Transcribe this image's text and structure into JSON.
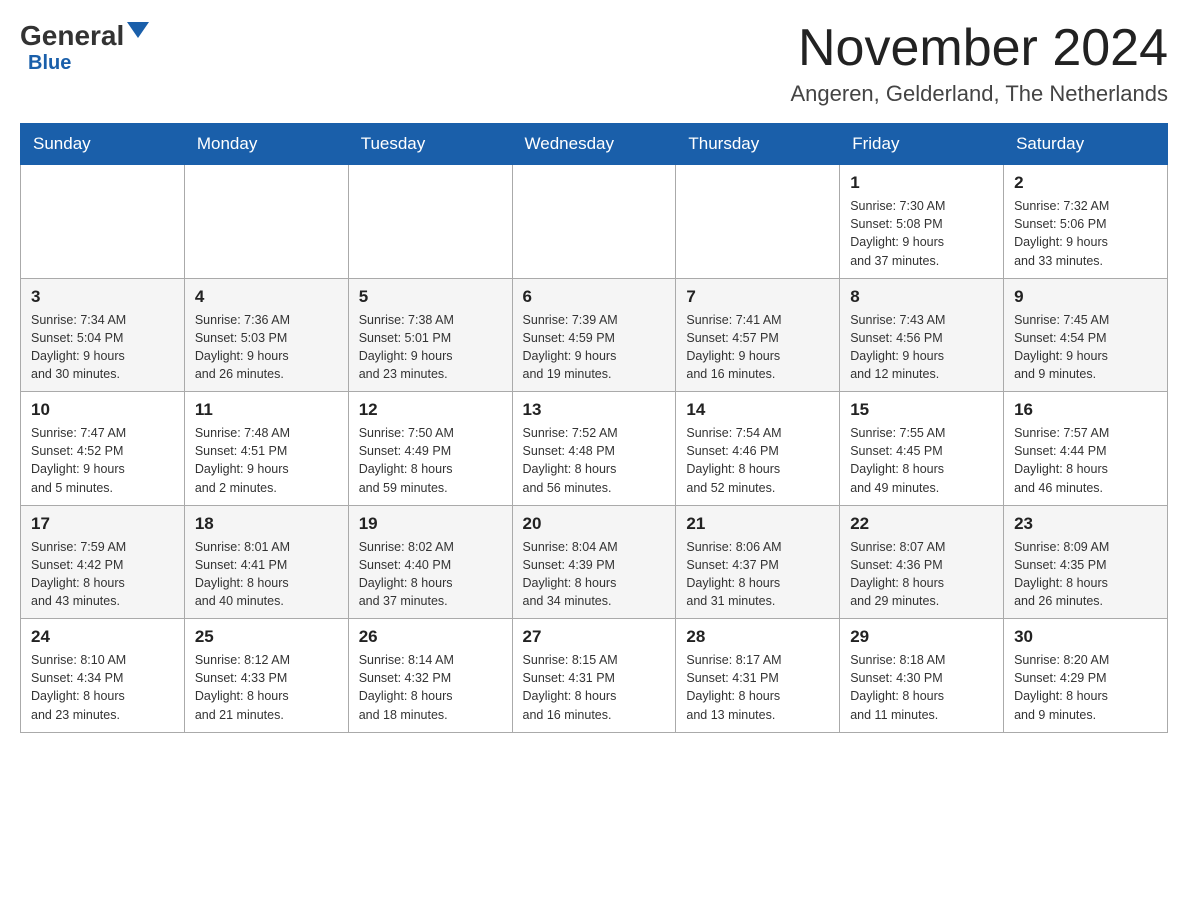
{
  "header": {
    "logo": {
      "general": "General",
      "blue": "Blue"
    },
    "title": "November 2024",
    "location": "Angeren, Gelderland, The Netherlands"
  },
  "calendar": {
    "days": [
      "Sunday",
      "Monday",
      "Tuesday",
      "Wednesday",
      "Thursday",
      "Friday",
      "Saturday"
    ],
    "weeks": [
      [
        {
          "day": "",
          "info": ""
        },
        {
          "day": "",
          "info": ""
        },
        {
          "day": "",
          "info": ""
        },
        {
          "day": "",
          "info": ""
        },
        {
          "day": "",
          "info": ""
        },
        {
          "day": "1",
          "info": "Sunrise: 7:30 AM\nSunset: 5:08 PM\nDaylight: 9 hours\nand 37 minutes."
        },
        {
          "day": "2",
          "info": "Sunrise: 7:32 AM\nSunset: 5:06 PM\nDaylight: 9 hours\nand 33 minutes."
        }
      ],
      [
        {
          "day": "3",
          "info": "Sunrise: 7:34 AM\nSunset: 5:04 PM\nDaylight: 9 hours\nand 30 minutes."
        },
        {
          "day": "4",
          "info": "Sunrise: 7:36 AM\nSunset: 5:03 PM\nDaylight: 9 hours\nand 26 minutes."
        },
        {
          "day": "5",
          "info": "Sunrise: 7:38 AM\nSunset: 5:01 PM\nDaylight: 9 hours\nand 23 minutes."
        },
        {
          "day": "6",
          "info": "Sunrise: 7:39 AM\nSunset: 4:59 PM\nDaylight: 9 hours\nand 19 minutes."
        },
        {
          "day": "7",
          "info": "Sunrise: 7:41 AM\nSunset: 4:57 PM\nDaylight: 9 hours\nand 16 minutes."
        },
        {
          "day": "8",
          "info": "Sunrise: 7:43 AM\nSunset: 4:56 PM\nDaylight: 9 hours\nand 12 minutes."
        },
        {
          "day": "9",
          "info": "Sunrise: 7:45 AM\nSunset: 4:54 PM\nDaylight: 9 hours\nand 9 minutes."
        }
      ],
      [
        {
          "day": "10",
          "info": "Sunrise: 7:47 AM\nSunset: 4:52 PM\nDaylight: 9 hours\nand 5 minutes."
        },
        {
          "day": "11",
          "info": "Sunrise: 7:48 AM\nSunset: 4:51 PM\nDaylight: 9 hours\nand 2 minutes."
        },
        {
          "day": "12",
          "info": "Sunrise: 7:50 AM\nSunset: 4:49 PM\nDaylight: 8 hours\nand 59 minutes."
        },
        {
          "day": "13",
          "info": "Sunrise: 7:52 AM\nSunset: 4:48 PM\nDaylight: 8 hours\nand 56 minutes."
        },
        {
          "day": "14",
          "info": "Sunrise: 7:54 AM\nSunset: 4:46 PM\nDaylight: 8 hours\nand 52 minutes."
        },
        {
          "day": "15",
          "info": "Sunrise: 7:55 AM\nSunset: 4:45 PM\nDaylight: 8 hours\nand 49 minutes."
        },
        {
          "day": "16",
          "info": "Sunrise: 7:57 AM\nSunset: 4:44 PM\nDaylight: 8 hours\nand 46 minutes."
        }
      ],
      [
        {
          "day": "17",
          "info": "Sunrise: 7:59 AM\nSunset: 4:42 PM\nDaylight: 8 hours\nand 43 minutes."
        },
        {
          "day": "18",
          "info": "Sunrise: 8:01 AM\nSunset: 4:41 PM\nDaylight: 8 hours\nand 40 minutes."
        },
        {
          "day": "19",
          "info": "Sunrise: 8:02 AM\nSunset: 4:40 PM\nDaylight: 8 hours\nand 37 minutes."
        },
        {
          "day": "20",
          "info": "Sunrise: 8:04 AM\nSunset: 4:39 PM\nDaylight: 8 hours\nand 34 minutes."
        },
        {
          "day": "21",
          "info": "Sunrise: 8:06 AM\nSunset: 4:37 PM\nDaylight: 8 hours\nand 31 minutes."
        },
        {
          "day": "22",
          "info": "Sunrise: 8:07 AM\nSunset: 4:36 PM\nDaylight: 8 hours\nand 29 minutes."
        },
        {
          "day": "23",
          "info": "Sunrise: 8:09 AM\nSunset: 4:35 PM\nDaylight: 8 hours\nand 26 minutes."
        }
      ],
      [
        {
          "day": "24",
          "info": "Sunrise: 8:10 AM\nSunset: 4:34 PM\nDaylight: 8 hours\nand 23 minutes."
        },
        {
          "day": "25",
          "info": "Sunrise: 8:12 AM\nSunset: 4:33 PM\nDaylight: 8 hours\nand 21 minutes."
        },
        {
          "day": "26",
          "info": "Sunrise: 8:14 AM\nSunset: 4:32 PM\nDaylight: 8 hours\nand 18 minutes."
        },
        {
          "day": "27",
          "info": "Sunrise: 8:15 AM\nSunset: 4:31 PM\nDaylight: 8 hours\nand 16 minutes."
        },
        {
          "day": "28",
          "info": "Sunrise: 8:17 AM\nSunset: 4:31 PM\nDaylight: 8 hours\nand 13 minutes."
        },
        {
          "day": "29",
          "info": "Sunrise: 8:18 AM\nSunset: 4:30 PM\nDaylight: 8 hours\nand 11 minutes."
        },
        {
          "day": "30",
          "info": "Sunrise: 8:20 AM\nSunset: 4:29 PM\nDaylight: 8 hours\nand 9 minutes."
        }
      ]
    ]
  }
}
